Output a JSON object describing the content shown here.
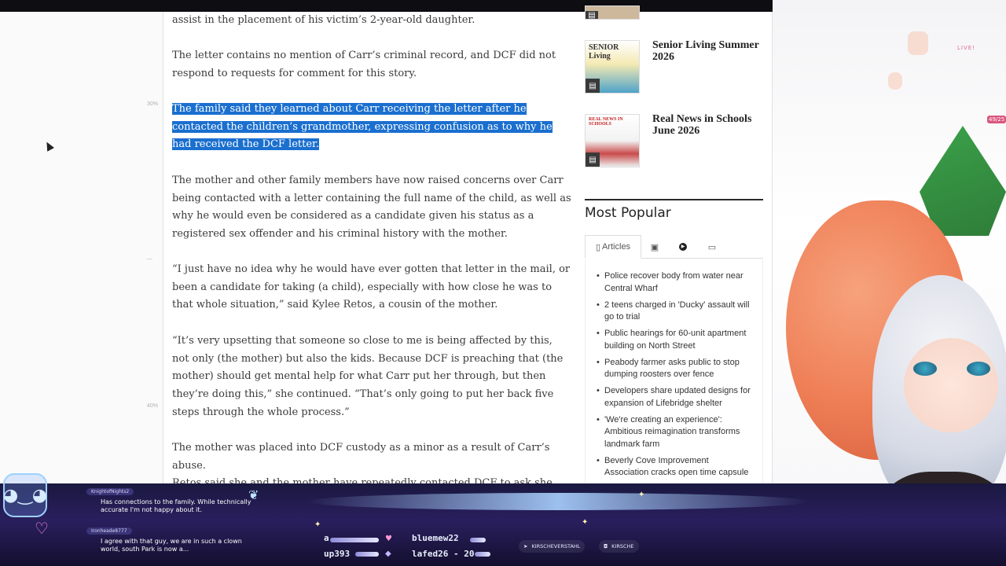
{
  "article": {
    "p1": "assist in the placement of his victim’s 2-year-old daughter.",
    "p2": "The letter contains no mention of Carr’s criminal record, and DCF did not respond to requests for comment for this story.",
    "p3_highlighted": "The family said they learned about Carr receiving the letter after he contacted the children’s grandmother, expressing confusion as to why he had received the DCF letter.",
    "p4": "The mother and other family members have now raised concerns over Carr being contacted with a letter containing the full name of the child, as well as why he would even be considered as a candidate given his status as a registered sex offender and his criminal history with the mother.",
    "p5": "“I just have no idea why he would have ever gotten that letter in the mail, or been a candidate for taking (a child), especially with how close he was to that whole situation,” said Kylee Retos, a cousin of the mother.",
    "p6": "“It’s very upsetting that someone so close to me is being affected by this, not only (the mother) but also the kids. Because DCF is preaching that (the mother) should get mental help for what Carr put her through, but then they’re doing this,” she continued. “That’s only going to put her back five steps through the whole process.”",
    "p7": "The mother was placed into DCF custody as a minor as a result of Carr’s abuse.",
    "p8_partial": "Retos said she and the mother have repeatedly contacted DCF to ask she (Retos)"
  },
  "gutter": {
    "mark1": "30%",
    "mark2": "40%"
  },
  "sidebar": {
    "publications": [
      {
        "title": "Senior Living Summer 2026",
        "thumb_text": "SENIOR Living"
      },
      {
        "title": "Real News in Schools June 2026",
        "thumb_text": "REAL NEWS IN SCHOOLS"
      }
    ],
    "most_popular_title": "Most Popular",
    "tabs": [
      {
        "label": "Articles",
        "icon": "document-icon"
      },
      {
        "label": "",
        "icon": "image-icon"
      },
      {
        "label": "",
        "icon": "play-icon"
      },
      {
        "label": "",
        "icon": "comment-icon"
      }
    ],
    "most_popular": [
      "Police recover body from water near Central Wharf",
      "2 teens charged in 'Ducky' assault will go to trial",
      "Public hearings for 60-unit apartment building on North Street",
      "Peabody farmer asks public to stop dumping roosters over fence",
      "Developers share updated designs for expansion of Lifebridge shelter",
      "'We're creating an experience': Ambitious reimagination transforms landmark farm",
      "Beverly Cove Improvement Association cracks open time capsule"
    ]
  },
  "stream": {
    "live_label": "LIVE!",
    "viewer_count": "49/25",
    "chat": [
      {
        "user": "KnightofNights2",
        "message": "Has connections to the family. While technically accurate I'm not happy about it."
      },
      {
        "user": "Ironheade8777",
        "message": "I agree with that guy, we are in such a clown world, south Park is now a..."
      }
    ],
    "ticker": [
      "a",
      "bluemew22",
      "up393",
      "lafed26 - 20"
    ],
    "socials": [
      "KIRSCHEVERSTAHL",
      "KIRSCHE"
    ]
  }
}
